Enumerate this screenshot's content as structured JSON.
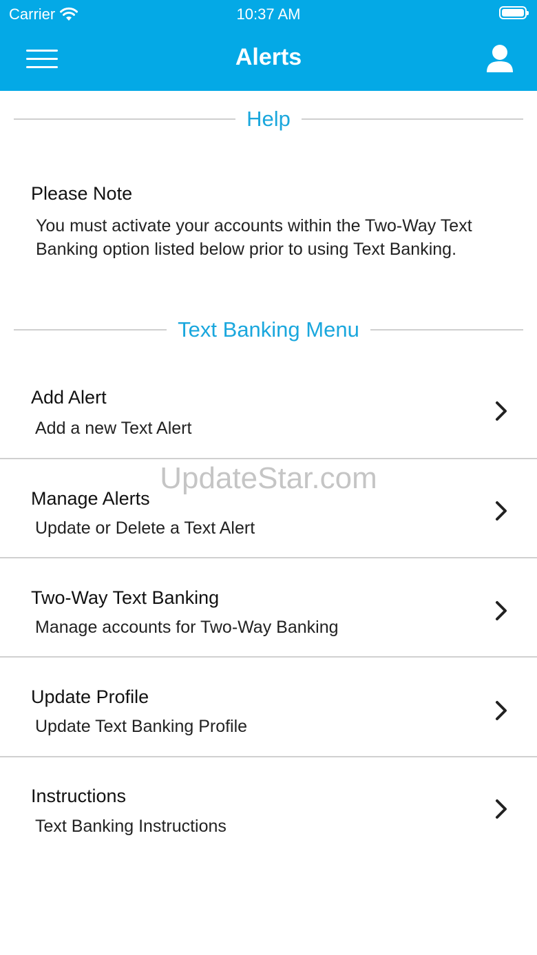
{
  "status_bar": {
    "carrier": "Carrier",
    "time": "10:37 AM"
  },
  "nav": {
    "title": "Alerts",
    "menu_icon": "hamburger-menu-icon",
    "profile_icon": "user-profile-icon"
  },
  "help_section": {
    "header": "Help",
    "note_title": "Please Note",
    "note_body": "You must activate your accounts within the Two-Way Text Banking option listed below prior to using Text Banking."
  },
  "menu_section": {
    "header": "Text Banking Menu",
    "items": [
      {
        "title": "Add Alert",
        "subtitle": "Add a new Text Alert"
      },
      {
        "title": "Manage Alerts",
        "subtitle": "Update or Delete a Text Alert"
      },
      {
        "title": "Two-Way Text Banking",
        "subtitle": "Manage accounts for Two-Way Banking"
      },
      {
        "title": "Update Profile",
        "subtitle": "Update Text Banking Profile"
      },
      {
        "title": "Instructions",
        "subtitle": "Text Banking Instructions"
      }
    ]
  },
  "watermark": "UpdateStar.com",
  "colors": {
    "brand": "#04a9e6",
    "section_header": "#1aa7dd",
    "divider": "#d0d0d0"
  }
}
